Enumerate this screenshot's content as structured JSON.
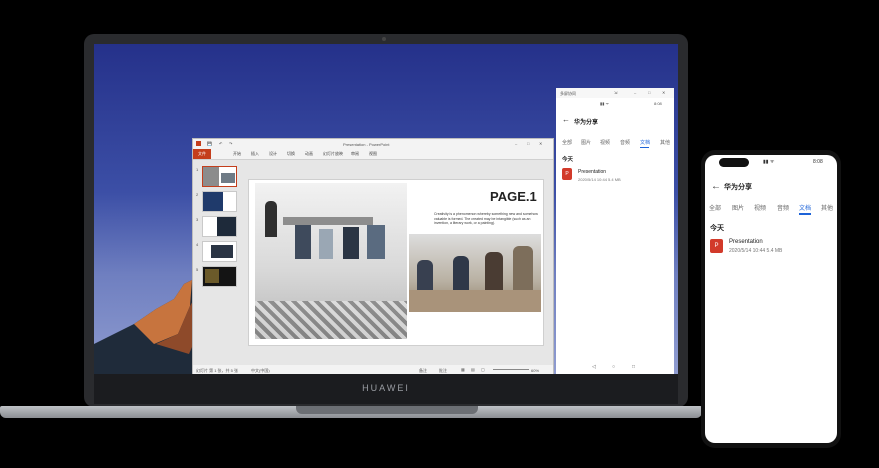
{
  "laptop": {
    "brand": "HUAWEI"
  },
  "powerpoint": {
    "window_title": "Presentation - PowerPoint",
    "file_tab": "文件",
    "ribbon_tabs": [
      "开始",
      "插入",
      "设计",
      "切换",
      "动画",
      "幻灯片放映",
      "审阅",
      "视图"
    ],
    "thumb_numbers": [
      "1",
      "2",
      "3",
      "4",
      "5"
    ],
    "slide": {
      "title": "PAGE.1",
      "body": "Creativity is a phenomenon whereby something new and somehow valuable is formed. The created may be intangible (such as an invention, a literary work, or a painting)."
    },
    "status_left": "幻灯片 第 1 张，共 5 张",
    "status_lang": "中文(中国)",
    "status_notes": "备注",
    "status_comments": "批注",
    "zoom": "60%"
  },
  "share_panel": {
    "window_title": "多屏协同",
    "status_time": "8:08",
    "title": "华为分享",
    "tabs": [
      "全部",
      "图片",
      "视频",
      "音频",
      "文档",
      "其他"
    ],
    "active_tab": "文档",
    "section": "今天",
    "file": {
      "icon_letter": "P",
      "name": "Presentation",
      "meta": "2020/5/14 10:44 5.4 MB"
    },
    "nav": [
      "◁",
      "○",
      "□"
    ]
  },
  "phone": {
    "status_time": "8:08",
    "title": "华为分享",
    "tabs": [
      "全部",
      "图片",
      "视频",
      "音频",
      "文档",
      "其他"
    ],
    "active_tab": "文档",
    "section": "今天",
    "file": {
      "icon_letter": "P",
      "name": "Presentation",
      "meta": "2020/5/14 10:44 5.4 MB"
    }
  },
  "colors": {
    "accent_blue": "#1d63d8",
    "ppt_red": "#c43e1c",
    "file_icon": "#d23a2a"
  }
}
